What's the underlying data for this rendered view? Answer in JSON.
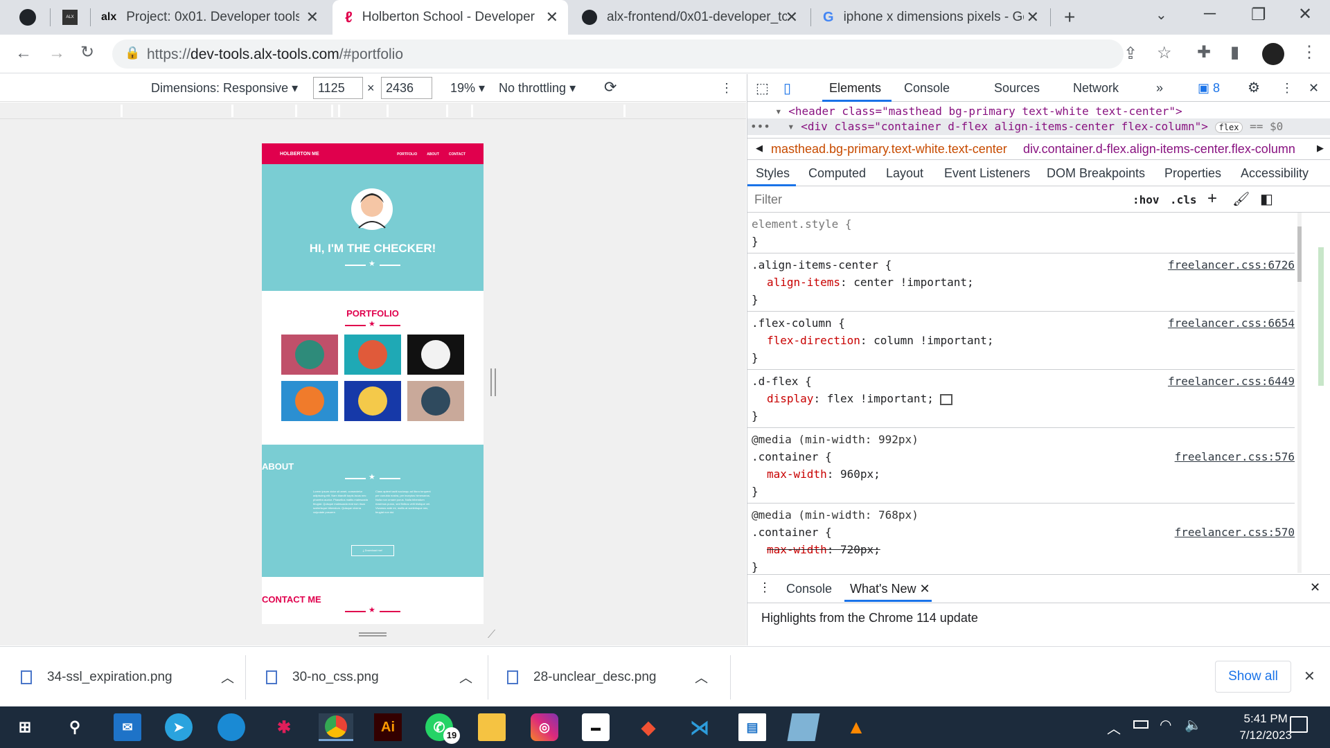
{
  "tabs": [
    {
      "title": "",
      "icon": "github-icon"
    },
    {
      "title": "",
      "icon": "alx-school-icon"
    },
    {
      "title": "Project: 0x01. Developer tools |",
      "icon": "alx-icon"
    },
    {
      "title": "Holberton School - Developer t",
      "icon": "holberton-icon"
    },
    {
      "title": "alx-frontend/0x01-developer_tc",
      "icon": "github-icon"
    },
    {
      "title": "iphone x dimensions pixels - Gc",
      "icon": "google-icon"
    }
  ],
  "address": {
    "scheme": "https://",
    "host": "dev-tools.alx-tools.com",
    "path": "/#portfolio"
  },
  "device_toolbar": {
    "dimensions_label": "Dimensions: Responsive",
    "width": "1125",
    "times": "×",
    "height": "2436",
    "zoom": "19%",
    "throttling": "No throttling"
  },
  "page": {
    "brand": "HOLBERTON ME",
    "nav_links": [
      "PORTFOLIO",
      "ABOUT",
      "CONTACT"
    ],
    "hero_title": "HI, I'M THE CHECKER!",
    "portfolio_title": "PORTFOLIO",
    "about_title": "ABOUT",
    "about_col1": "Lorem ipsum dolor sit amet, consectetur adipiscing elit. Nam blandit turpis lacus nec pharetra auctor. Phasellus mattis malesuada feugiat. Quisque malesuada erat non risus scelerisque bibendum. Quisque viverra vulputate posuere.",
    "about_col2": "Class aptent taciti sociosqu ad litora torquent per conubia nostra, per inceptos himenaeos. Nulla non ornare purus. Nulla bibendum maximus purus, sed finibus velit tristique vel. Vivamus ante mi, mollis at scelerisque nec, feugiat non dui.",
    "download_label": "Download me!",
    "contact_title": "CONTACT ME",
    "colors": {
      "primary": "#e0004d",
      "teal": "#7acdd3"
    }
  },
  "devtools": {
    "tabs": [
      "Elements",
      "Console",
      "Sources",
      "Network"
    ],
    "issues_count": "8",
    "dom_line1": "<header class=\"masthead bg-primary text-white text-center\">",
    "dom_line2_tag": "<div class=\"container d-flex align-items-center flex-column\">",
    "dom_badge": "flex",
    "dom_eq": "== $0",
    "crumb1": "masthead.bg-primary.text-white.text-center",
    "crumb2": "div.container.d-flex.align-items-center.flex-column",
    "subtabs": [
      "Styles",
      "Computed",
      "Layout",
      "Event Listeners",
      "DOM Breakpoints",
      "Properties",
      "Accessibility"
    ],
    "filter_placeholder": "Filter",
    "hov": ":hov",
    "cls": ".cls",
    "rules": [
      {
        "media": "",
        "selector": "element.style {",
        "src": "",
        "prop": "",
        "value": "",
        "struck": false
      },
      {
        "media": "",
        "selector": ".align-items-center {",
        "src": "freelancer.css:6726",
        "prop": "align-items",
        "value": ": center !important;",
        "struck": false
      },
      {
        "media": "",
        "selector": ".flex-column {",
        "src": "freelancer.css:6654",
        "prop": "flex-direction",
        "value": ": column !important;",
        "struck": false
      },
      {
        "media": "",
        "selector": ".d-flex {",
        "src": "freelancer.css:6449",
        "prop": "display",
        "value": ": flex !important;",
        "struck": false
      },
      {
        "media": "@media (min-width: 992px)",
        "selector": ".container {",
        "src": "freelancer.css:576",
        "prop": "max-width",
        "value": ": 960px;",
        "struck": false
      },
      {
        "media": "@media (min-width: 768px)",
        "selector": ".container {",
        "src": "freelancer.css:570",
        "prop": "max-width",
        "value": ": 720px;",
        "struck": true
      }
    ],
    "drawer_tabs": [
      "Console",
      "What's New"
    ],
    "drawer_text": "Highlights from the Chrome 114 update"
  },
  "downloads": [
    "34-ssl_expiration.png",
    "30-no_css.png",
    "28-unclear_desc.png"
  ],
  "show_all": "Show all",
  "taskbar": {
    "whatsapp_badge": "19",
    "time": "5:41 PM",
    "date": "7/12/2023"
  }
}
